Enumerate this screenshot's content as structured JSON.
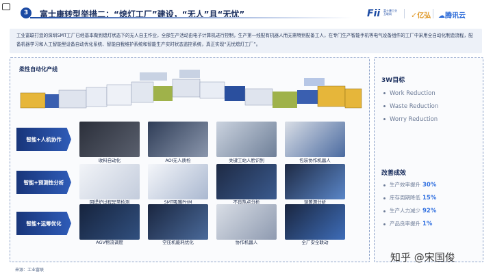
{
  "header": {
    "number": "3",
    "title": "富士康转型举措二：“熄灯工厂”建设，“无人”且“无忧”",
    "logo_fii": "Fii",
    "logo_fii_sub": "富士康工业互联网",
    "logo_yun": "亿弘",
    "logo_tengxun": "腾讯云"
  },
  "intro": "工业富联打造的深圳SMT工厂已经基本做到熄灯状态下的无人自主作业，全部生产活动由电子计算机进行控制，生产第一线配有机器人而无需特别配备工人，在专门生产智能手机等电气设备组件的工厂中采用全自动化制造流程，配备机器学习和人工智能型设备自动优化系统、智能自我维护系统和智能生产实时状态监控系统，真正实现“无忧熄灯工厂”。",
  "production_line": {
    "title": "柔性自动化产线"
  },
  "rows": [
    {
      "label": "智能+人机协作",
      "items": [
        "收料自动化",
        "AOI无人质检",
        "关键工站人脸识别",
        "包装协作机器人"
      ]
    },
    {
      "label": "智能+预测性分析",
      "items": [
        "回焊炉过程异常检测",
        "SMT吸嘴PHM",
        "不良热点分析",
        "误差源分析"
      ]
    },
    {
      "label": "智能+运筹优化",
      "items": [
        "AGV物流调度",
        "空压机能耗优化",
        "协作机器人",
        "全厂安全联动"
      ]
    }
  ],
  "goals": {
    "title": "3W目标",
    "items": [
      "Work Reduction",
      "Waste Reduction",
      "Worry Reduction"
    ]
  },
  "achievements": {
    "title": "改善成效",
    "items": [
      {
        "label": "生产效率提升",
        "value": "30%"
      },
      {
        "label": "库存周期降低",
        "value": "15%"
      },
      {
        "label": "生产人力减少",
        "value": "92%"
      },
      {
        "label": "产品良率提升",
        "value": "1%"
      }
    ]
  },
  "source": "来源：工业富联",
  "watermark": "知乎 @宋国俊",
  "colors": {
    "primary": "#1b4aa3",
    "accent": "#2f6fe0",
    "label_bg": "#18357a"
  }
}
